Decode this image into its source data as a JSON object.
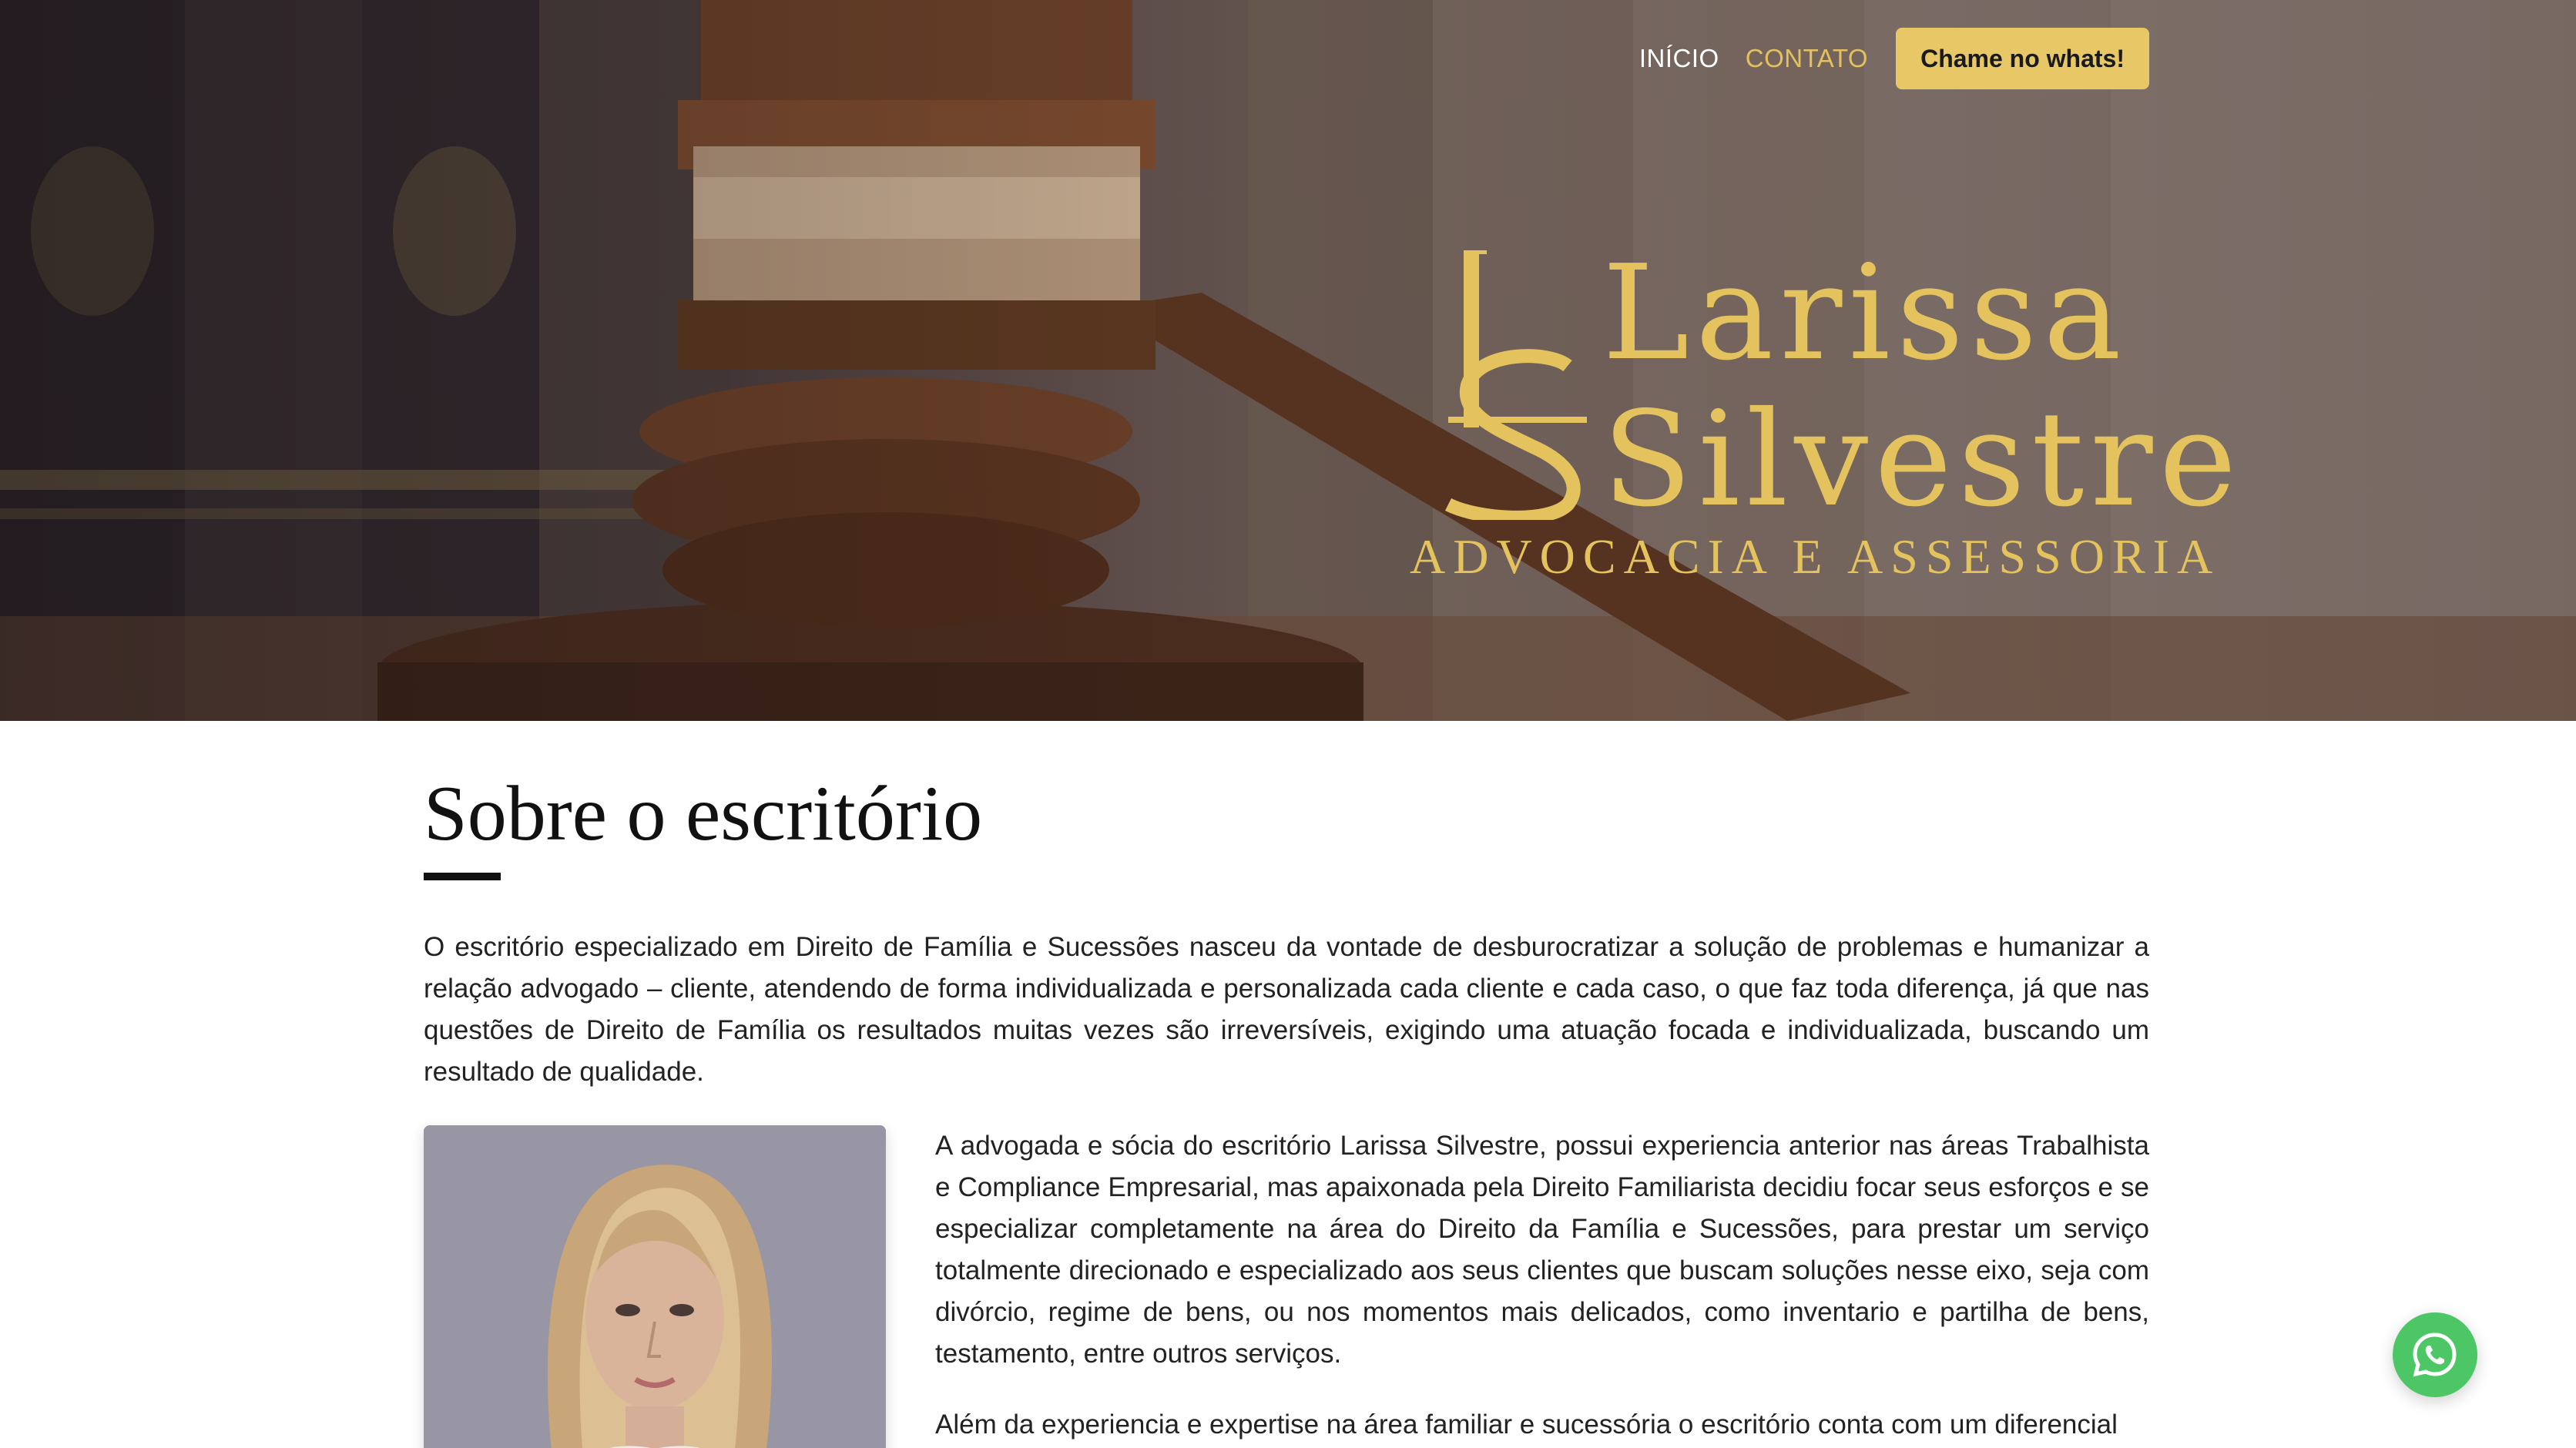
{
  "nav": {
    "links": [
      "INÍCIO",
      "CONTATO"
    ],
    "cta": "Chame no whats!"
  },
  "logo": {
    "first_name": "Larissa",
    "last_name": "Silvestre",
    "tagline": "ADVOCACIA E ASSESSORIA",
    "monogram": "LS"
  },
  "about": {
    "title": "Sobre o escritório",
    "intro": "O escritório especializado em Direito de Família e Sucessões nasceu da vontade de desburocratizar a solução de problemas e humanizar a relação advogado – cliente, atendendo de forma individualizada e personalizada cada cliente e cada caso, o que faz toda diferença, já que nas questões de Direito de Família os resultados muitas vezes são irreversíveis, exigindo uma atuação focada e individualizada, buscando um resultado de qualidade.",
    "paragraph_1": "A advogada e sócia do escritório Larissa Silvestre, possui experiencia anterior nas áreas Trabalhista e Compliance Empresarial, mas apaixonada pela Direito Familiarista decidiu focar seus esforços e se especializar completamente na área do Direito da Família e Sucessões, para prestar um serviço totalmente direcionado e especializado aos seus clientes que buscam soluções nesse eixo, seja com divórcio, regime de bens, ou nos momentos mais delicados, como inventario e partilha de bens, testamento, entre outros serviços.",
    "paragraph_2": "Além da experiencia e expertise na área familiar e sucessória o escritório conta com um diferencial"
  },
  "colors": {
    "gold": "#e4c35f",
    "button": "#e8c767",
    "whatsapp": "#4dc766"
  },
  "icons": {
    "float": "whatsapp-icon"
  }
}
